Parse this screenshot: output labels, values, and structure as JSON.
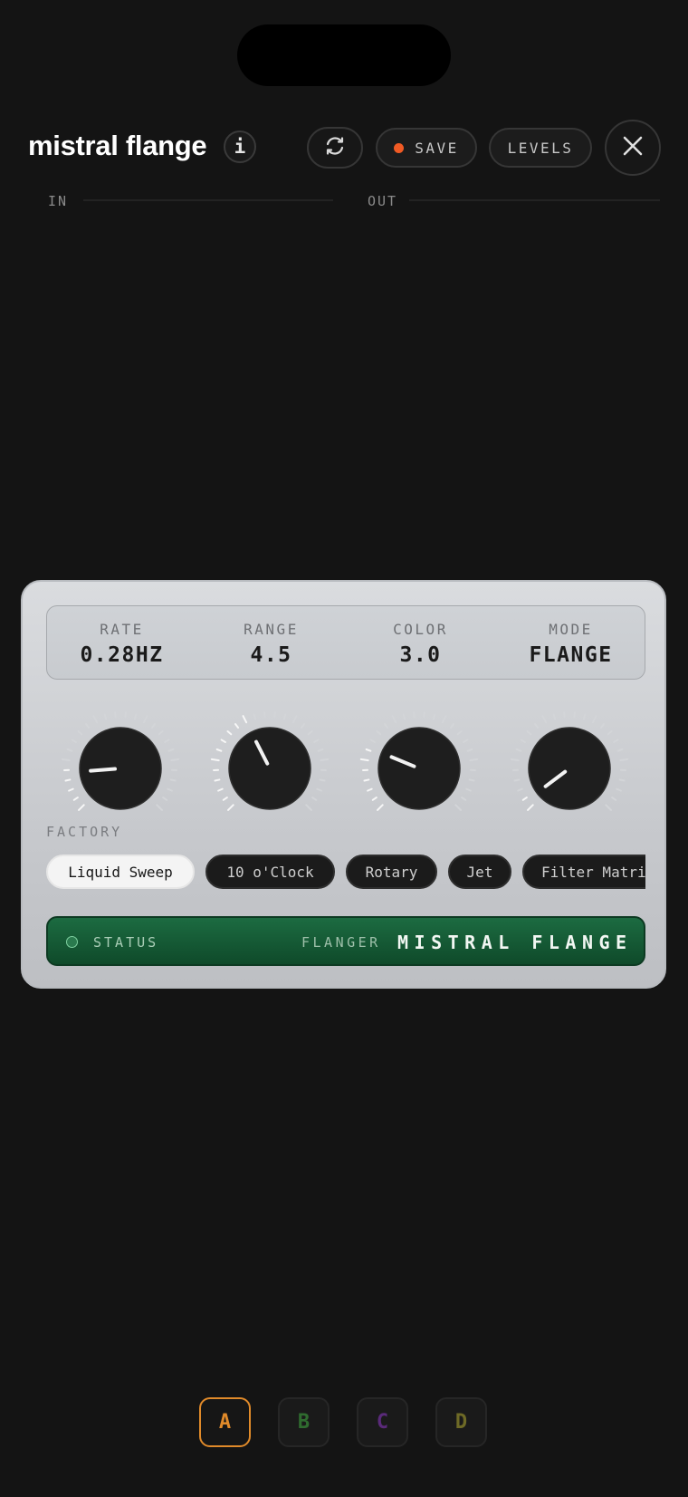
{
  "header": {
    "title": "mistral flange",
    "info_label": "i",
    "save_label": "SAVE",
    "levels_label": "LEVELS",
    "save_dot_color": "#f05a24"
  },
  "meters": {
    "in_label": "IN",
    "out_label": "OUT"
  },
  "readout": [
    {
      "label": "RATE",
      "value": "0.28HZ"
    },
    {
      "label": "RANGE",
      "value": "4.5"
    },
    {
      "label": "COLOR",
      "value": "3.0"
    },
    {
      "label": "MODE",
      "value": "FLANGE"
    }
  ],
  "knobs": [
    {
      "param": "rate",
      "level": 0.15
    },
    {
      "param": "range",
      "level": 0.4
    },
    {
      "param": "color",
      "level": 0.25
    },
    {
      "param": "mode",
      "level": 0.03
    }
  ],
  "factory": {
    "label": "FACTORY",
    "presets": [
      "Liquid Sweep",
      "10 o'Clock",
      "Rotary",
      "Jet",
      "Filter Matrix"
    ],
    "selected": "Liquid Sweep"
  },
  "status": {
    "label": "STATUS",
    "type": "FLANGER",
    "name": "MISTRAL FLANGE",
    "bar_color": "#1c6b41"
  },
  "banks": [
    {
      "label": "A",
      "color": "#e08a2a",
      "active": true
    },
    {
      "label": "B",
      "color": "#2f6b2f",
      "active": false
    },
    {
      "label": "C",
      "color": "#5a2a7a",
      "active": false
    },
    {
      "label": "D",
      "color": "#6e6a26",
      "active": false
    }
  ]
}
